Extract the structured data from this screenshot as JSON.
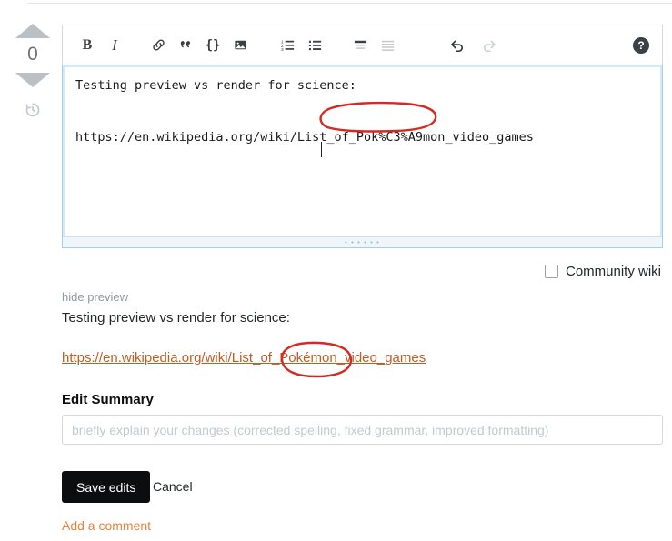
{
  "vote": {
    "count": "0",
    "up_title": "up-vote",
    "down_title": "down-vote",
    "history_title": "edit history"
  },
  "toolbar": {
    "bold": "B",
    "italic": "I",
    "link": "link-icon",
    "quote": "””",
    "code": "{}",
    "image": "image-icon",
    "numbered_list": "numbered-list-icon",
    "bulleted_list": "bulleted-list-icon",
    "heading": "heading-icon",
    "horizontal_rule": "horizontal-rule-icon",
    "undo": "↶",
    "redo": "↷",
    "help": "?"
  },
  "editor": {
    "line1": "Testing preview vs render for science:",
    "line2": "https://en.wikipedia.org/wiki/List_of_Pok%C3%A9mon_video_games"
  },
  "community_wiki": {
    "label": "Community wiki",
    "checked": false
  },
  "preview": {
    "toggle_label": "hide preview",
    "text": "Testing preview vs render for science:",
    "link": "https://en.wikipedia.org/wiki/List_of_Pokémon_video_games"
  },
  "summary": {
    "label": "Edit Summary",
    "value": "",
    "placeholder": "briefly explain your changes (corrected spelling, fixed grammar, improved formatting)"
  },
  "actions": {
    "save": "Save edits",
    "cancel": "Cancel",
    "add_comment": "Add a comment"
  },
  "annotations": {
    "color": "#d42a22",
    "circle1_target": "of_Pok%C3%A9mon",
    "circle2_target": "Pokémon_v"
  }
}
